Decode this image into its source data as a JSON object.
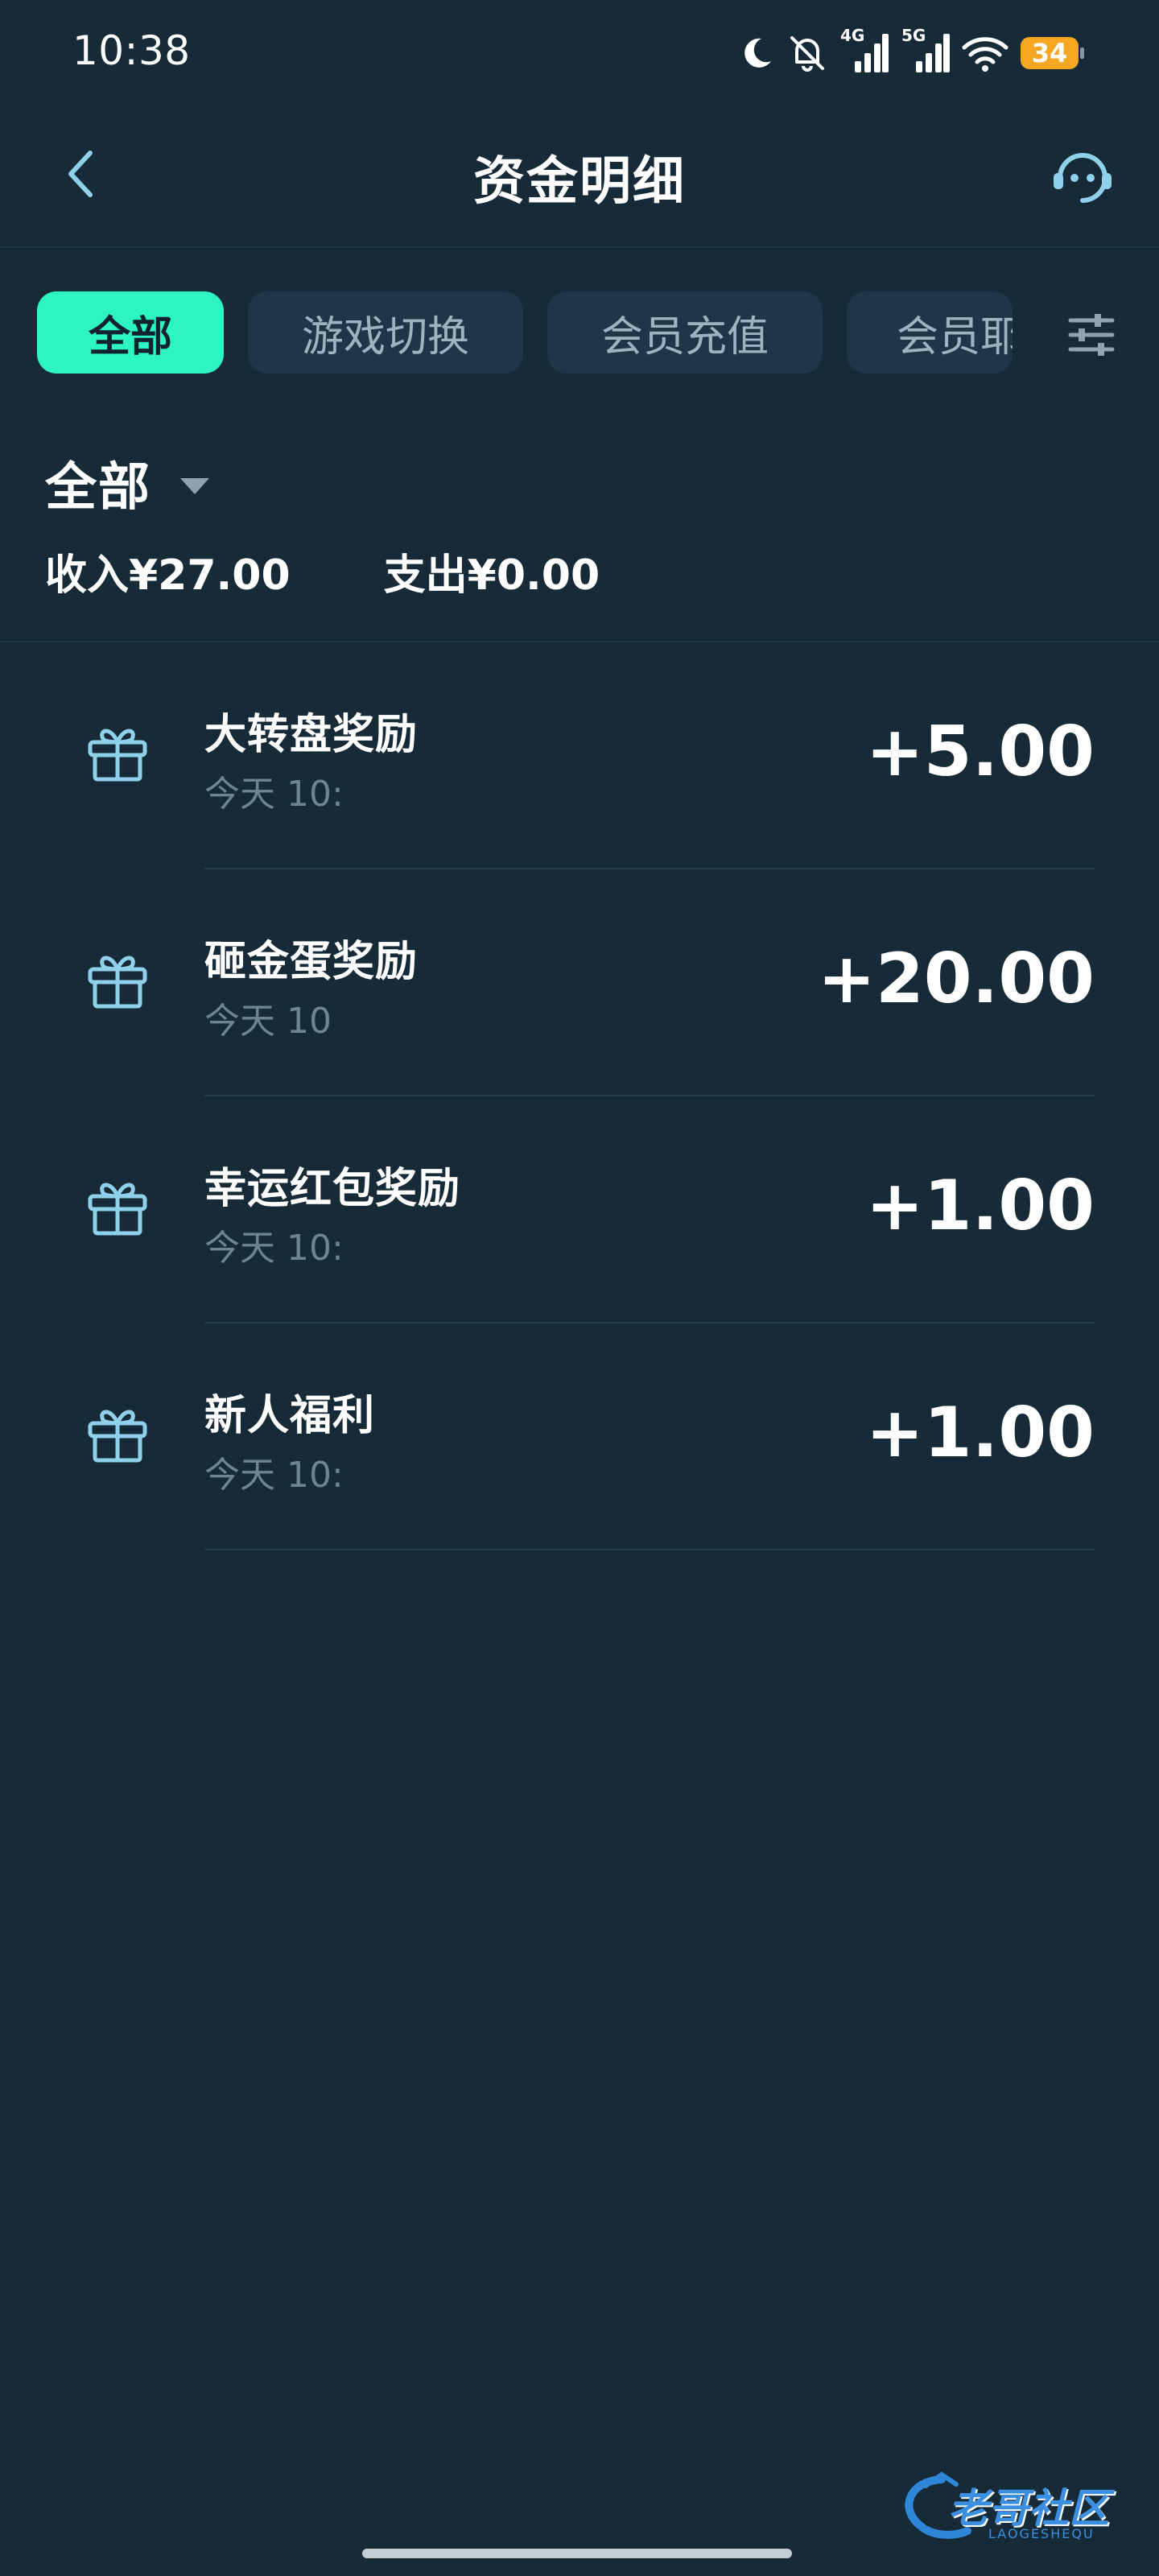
{
  "status_bar": {
    "time": "10:38",
    "network_4g": "4G",
    "network_5g": "5G",
    "battery": "34",
    "icons": [
      "moon-icon",
      "bell-off-icon",
      "signal-4g-icon",
      "signal-5g-icon",
      "wifi-icon",
      "battery-icon"
    ]
  },
  "nav": {
    "title": "资金明细",
    "back_icon": "chevron-left-icon",
    "service_icon": "customer-service-icon"
  },
  "tabs": [
    {
      "label": "全部",
      "active": true
    },
    {
      "label": "游戏切换",
      "active": false
    },
    {
      "label": "会员充值",
      "active": false
    },
    {
      "label": "会员耶",
      "active": false
    }
  ],
  "filter_icon": "sliders-icon",
  "summary": {
    "filter_label": "全部",
    "income": "收入¥27.00",
    "expense": "支出¥0.00"
  },
  "transactions": [
    {
      "title": "大转盘奖励",
      "time": "今天 10:",
      "amount": "+5.00",
      "icon": "gift-icon"
    },
    {
      "title": "砸金蛋奖励",
      "time": "今天 10",
      "amount": "+20.00",
      "icon": "gift-icon"
    },
    {
      "title": "幸运红包奖励",
      "time": "今天 10:",
      "amount": "+1.00",
      "icon": "gift-icon"
    },
    {
      "title": "新人福利",
      "time": "今天 10:",
      "amount": "+1.00",
      "icon": "gift-icon"
    }
  ],
  "colors": {
    "background": "#172a38",
    "accent": "#2df5bf",
    "tab_bg": "#1f3646",
    "icon_blue": "#8fd0ea",
    "battery": "#f5a623"
  },
  "watermark": {
    "text": "老哥社区",
    "subtext": "LAOGESHEQU"
  }
}
